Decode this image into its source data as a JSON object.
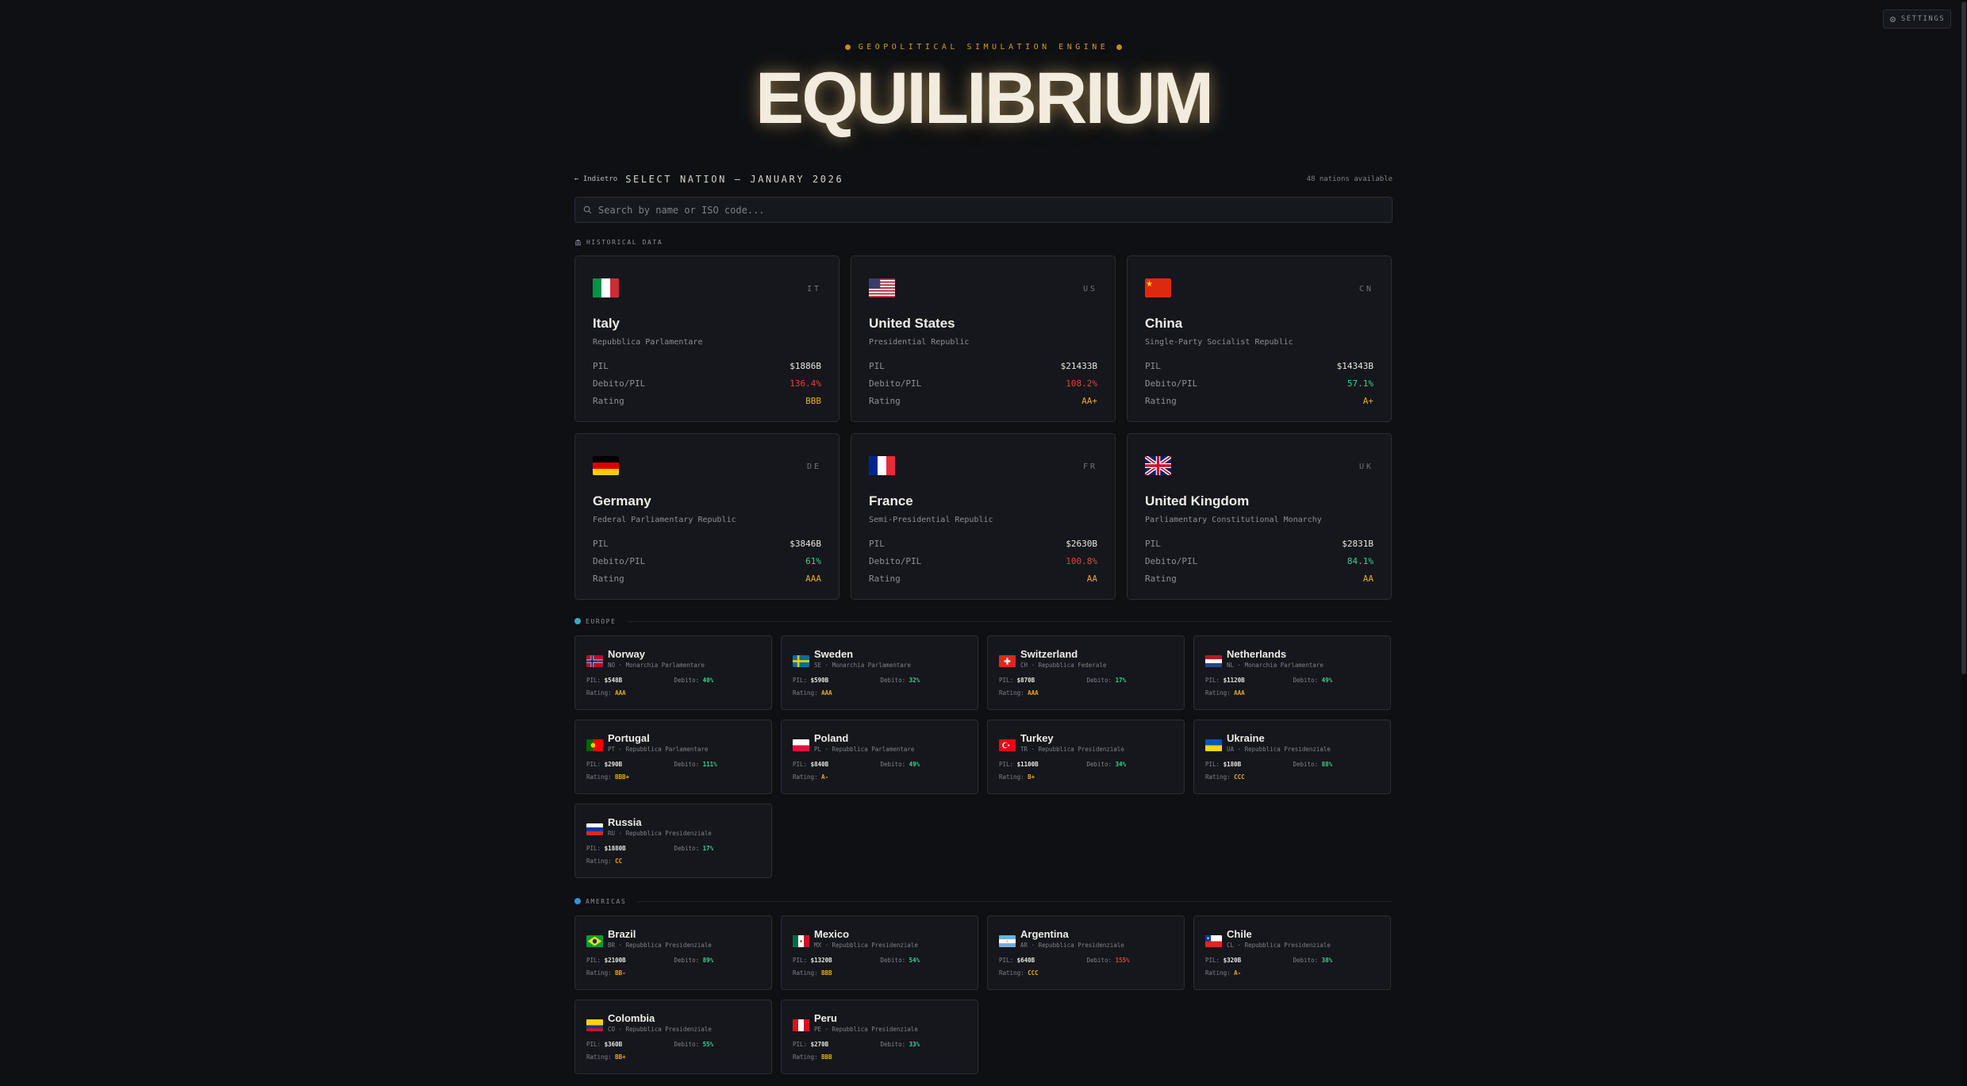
{
  "settings": {
    "label": "SETTINGS"
  },
  "header": {
    "tagline": "GEOPOLITICAL SIMULATION ENGINE",
    "title": "EQUILIBRIUM"
  },
  "nav": {
    "back_label": "← Indietro",
    "screen_title": "SELECT NATION — JANUARY 2026",
    "available": "48 nations available"
  },
  "search": {
    "placeholder": "Search by name or ISO code..."
  },
  "colors": {
    "accent": "#d09a2c",
    "bad": "#e0443a",
    "good": "#3ecf8e",
    "rating": "#e8a92a"
  },
  "historical": {
    "label": "HISTORICAL DATA",
    "icon": "bank-icon",
    "nations": [
      {
        "iso": "IT",
        "flag": "it",
        "name": "Italy",
        "gov": "Repubblica Parlamentare",
        "pil_label": "PIL",
        "pil": "$1886B",
        "debt_label": "Debito/PIL",
        "debt": "136.4%",
        "debt_status": "bad",
        "rating_label": "Rating",
        "rating": "BBB"
      },
      {
        "iso": "US",
        "flag": "us",
        "name": "United States",
        "gov": "Presidential Republic",
        "pil_label": "PIL",
        "pil": "$21433B",
        "debt_label": "Debito/PIL",
        "debt": "108.2%",
        "debt_status": "bad",
        "rating_label": "Rating",
        "rating": "AA+"
      },
      {
        "iso": "CN",
        "flag": "cn",
        "name": "China",
        "gov": "Single-Party Socialist Republic",
        "pil_label": "PIL",
        "pil": "$14343B",
        "debt_label": "Debito/PIL",
        "debt": "57.1%",
        "debt_status": "good",
        "rating_label": "Rating",
        "rating": "A+"
      },
      {
        "iso": "DE",
        "flag": "de",
        "name": "Germany",
        "gov": "Federal Parliamentary Republic",
        "pil_label": "PIL",
        "pil": "$3846B",
        "debt_label": "Debito/PIL",
        "debt": "61%",
        "debt_status": "good",
        "rating_label": "Rating",
        "rating": "AAA"
      },
      {
        "iso": "FR",
        "flag": "fr",
        "name": "France",
        "gov": "Semi-Presidential Republic",
        "pil_label": "PIL",
        "pil": "$2630B",
        "debt_label": "Debito/PIL",
        "debt": "100.8%",
        "debt_status": "bad",
        "rating_label": "Rating",
        "rating": "AA"
      },
      {
        "iso": "UK",
        "flag": "uk",
        "name": "United Kingdom",
        "gov": "Parliamentary Constitutional Monarchy",
        "pil_label": "PIL",
        "pil": "$2831B",
        "debt_label": "Debito/PIL",
        "debt": "84.1%",
        "debt_status": "good",
        "rating_label": "Rating",
        "rating": "AA"
      }
    ]
  },
  "regions": [
    {
      "label": "EUROPE",
      "dot_color": "#3aa8c9",
      "nations": [
        {
          "flag": "no",
          "name": "Norway",
          "sub": "NO · Monarchia Parlamentare",
          "pil": "$548B",
          "debt": "40%",
          "debt_status": "good",
          "rating": "AAA"
        },
        {
          "flag": "se",
          "name": "Sweden",
          "sub": "SE · Monarchia Parlamentare",
          "pil": "$590B",
          "debt": "32%",
          "debt_status": "good",
          "rating": "AAA"
        },
        {
          "flag": "ch",
          "name": "Switzerland",
          "sub": "CH · Repubblica Federale",
          "pil": "$870B",
          "debt": "17%",
          "debt_status": "good",
          "rating": "AAA"
        },
        {
          "flag": "nl",
          "name": "Netherlands",
          "sub": "NL · Monarchia Parlamentare",
          "pil": "$1120B",
          "debt": "49%",
          "debt_status": "good",
          "rating": "AAA"
        },
        {
          "flag": "pt",
          "name": "Portugal",
          "sub": "PT · Repubblica Parlamentare",
          "pil": "$290B",
          "debt": "111%",
          "debt_status": "good",
          "rating": "BBB+"
        },
        {
          "flag": "pl",
          "name": "Poland",
          "sub": "PL · Repubblica Parlamentare",
          "pil": "$840B",
          "debt": "49%",
          "debt_status": "good",
          "rating": "A-"
        },
        {
          "flag": "tr",
          "name": "Turkey",
          "sub": "TR · Repubblica Presidenziale",
          "pil": "$1100B",
          "debt": "34%",
          "debt_status": "good",
          "rating": "B+"
        },
        {
          "flag": "ua",
          "name": "Ukraine",
          "sub": "UA · Repubblica Presidenziale",
          "pil": "$180B",
          "debt": "88%",
          "debt_status": "good",
          "rating": "CCC"
        },
        {
          "flag": "ru",
          "name": "Russia",
          "sub": "RU · Repubblica Presidenziale",
          "pil": "$1880B",
          "debt": "17%",
          "debt_status": "good",
          "rating": "CC"
        }
      ]
    },
    {
      "label": "AMERICAS",
      "dot_color": "#3a8fd9",
      "nations": [
        {
          "flag": "br",
          "name": "Brazil",
          "sub": "BR · Repubblica Presidenziale",
          "pil": "$2100B",
          "debt": "89%",
          "debt_status": "good",
          "rating": "BB-"
        },
        {
          "flag": "mx",
          "name": "Mexico",
          "sub": "MX · Repubblica Presidenziale",
          "pil": "$1320B",
          "debt": "54%",
          "debt_status": "good",
          "rating": "BBB"
        },
        {
          "flag": "ar",
          "name": "Argentina",
          "sub": "AR · Repubblica Presidenziale",
          "pil": "$640B",
          "debt": "155%",
          "debt_status": "bad",
          "rating": "CCC"
        },
        {
          "flag": "cl",
          "name": "Chile",
          "sub": "CL · Repubblica Presidenziale",
          "pil": "$320B",
          "debt": "38%",
          "debt_status": "good",
          "rating": "A-"
        },
        {
          "flag": "co",
          "name": "Colombia",
          "sub": "CO · Repubblica Presidenziale",
          "pil": "$360B",
          "debt": "55%",
          "debt_status": "good",
          "rating": "BB+"
        },
        {
          "flag": "pe",
          "name": "Peru",
          "sub": "PE · Repubblica Presidenziale",
          "pil": "$270B",
          "debt": "33%",
          "debt_status": "good",
          "rating": "BBB"
        }
      ]
    }
  ],
  "labels": {
    "pil": "PIL:",
    "debt": "Debito:",
    "rating": "Rating:"
  }
}
